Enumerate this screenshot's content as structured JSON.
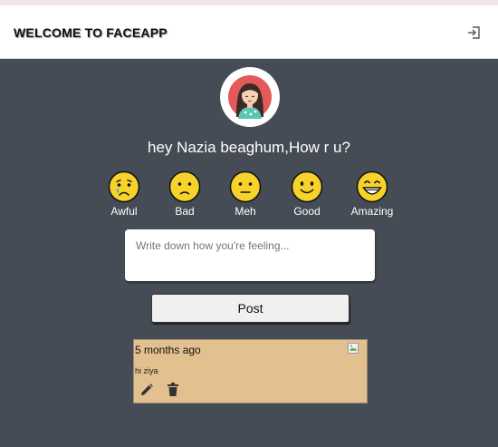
{
  "header": {
    "title": "WELCOME TO FACEAPP",
    "logout_icon": "logout-icon"
  },
  "user": {
    "greeting": "hey Nazia beaghum,How r u?"
  },
  "moods": [
    {
      "label": "Awful",
      "icon": "crying-face-icon"
    },
    {
      "label": "Bad",
      "icon": "sad-face-icon"
    },
    {
      "label": "Meh",
      "icon": "neutral-face-icon"
    },
    {
      "label": "Good",
      "icon": "smiling-face-icon"
    },
    {
      "label": "Amazing",
      "icon": "grinning-face-icon"
    }
  ],
  "composer": {
    "placeholder": "Write down how you're feeling...",
    "post_label": "Post"
  },
  "posts": [
    {
      "time": "5 months ago",
      "text": "hi ziya"
    }
  ],
  "colors": {
    "background": "#464c55",
    "header": "#ffffff",
    "emoji": "#f7d22b",
    "post_card": "#e2c08f"
  }
}
